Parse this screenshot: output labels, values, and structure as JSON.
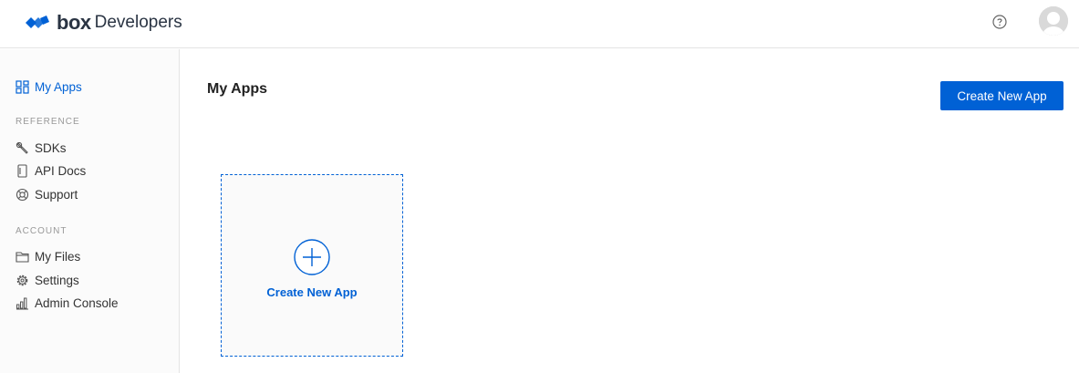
{
  "header": {
    "logo_box": "box",
    "logo_developers": "Developers",
    "help_icon": "question-circle-icon",
    "avatar_icon": "user-avatar-icon"
  },
  "sidebar": {
    "my_apps": {
      "label": "My Apps",
      "icon": "grid-icon"
    },
    "reference_label": "REFERENCE",
    "reference_items": [
      {
        "label": "SDKs",
        "icon": "wrench-icon"
      },
      {
        "label": "API Docs",
        "icon": "document-icon"
      },
      {
        "label": "Support",
        "icon": "lifebuoy-icon"
      }
    ],
    "account_label": "ACCOUNT",
    "account_items": [
      {
        "label": "My Files",
        "icon": "folder-icon"
      },
      {
        "label": "Settings",
        "icon": "gear-icon"
      },
      {
        "label": "Admin Console",
        "icon": "bar-chart-icon"
      }
    ]
  },
  "main": {
    "title": "My Apps",
    "create_button": "Create New App",
    "card_label": "Create New App",
    "card_icon": "plus-circle-icon"
  },
  "colors": {
    "accent": "#0061d5",
    "text": "#222222",
    "muted": "#999999",
    "sidebar_bg": "#fbfbfb"
  }
}
